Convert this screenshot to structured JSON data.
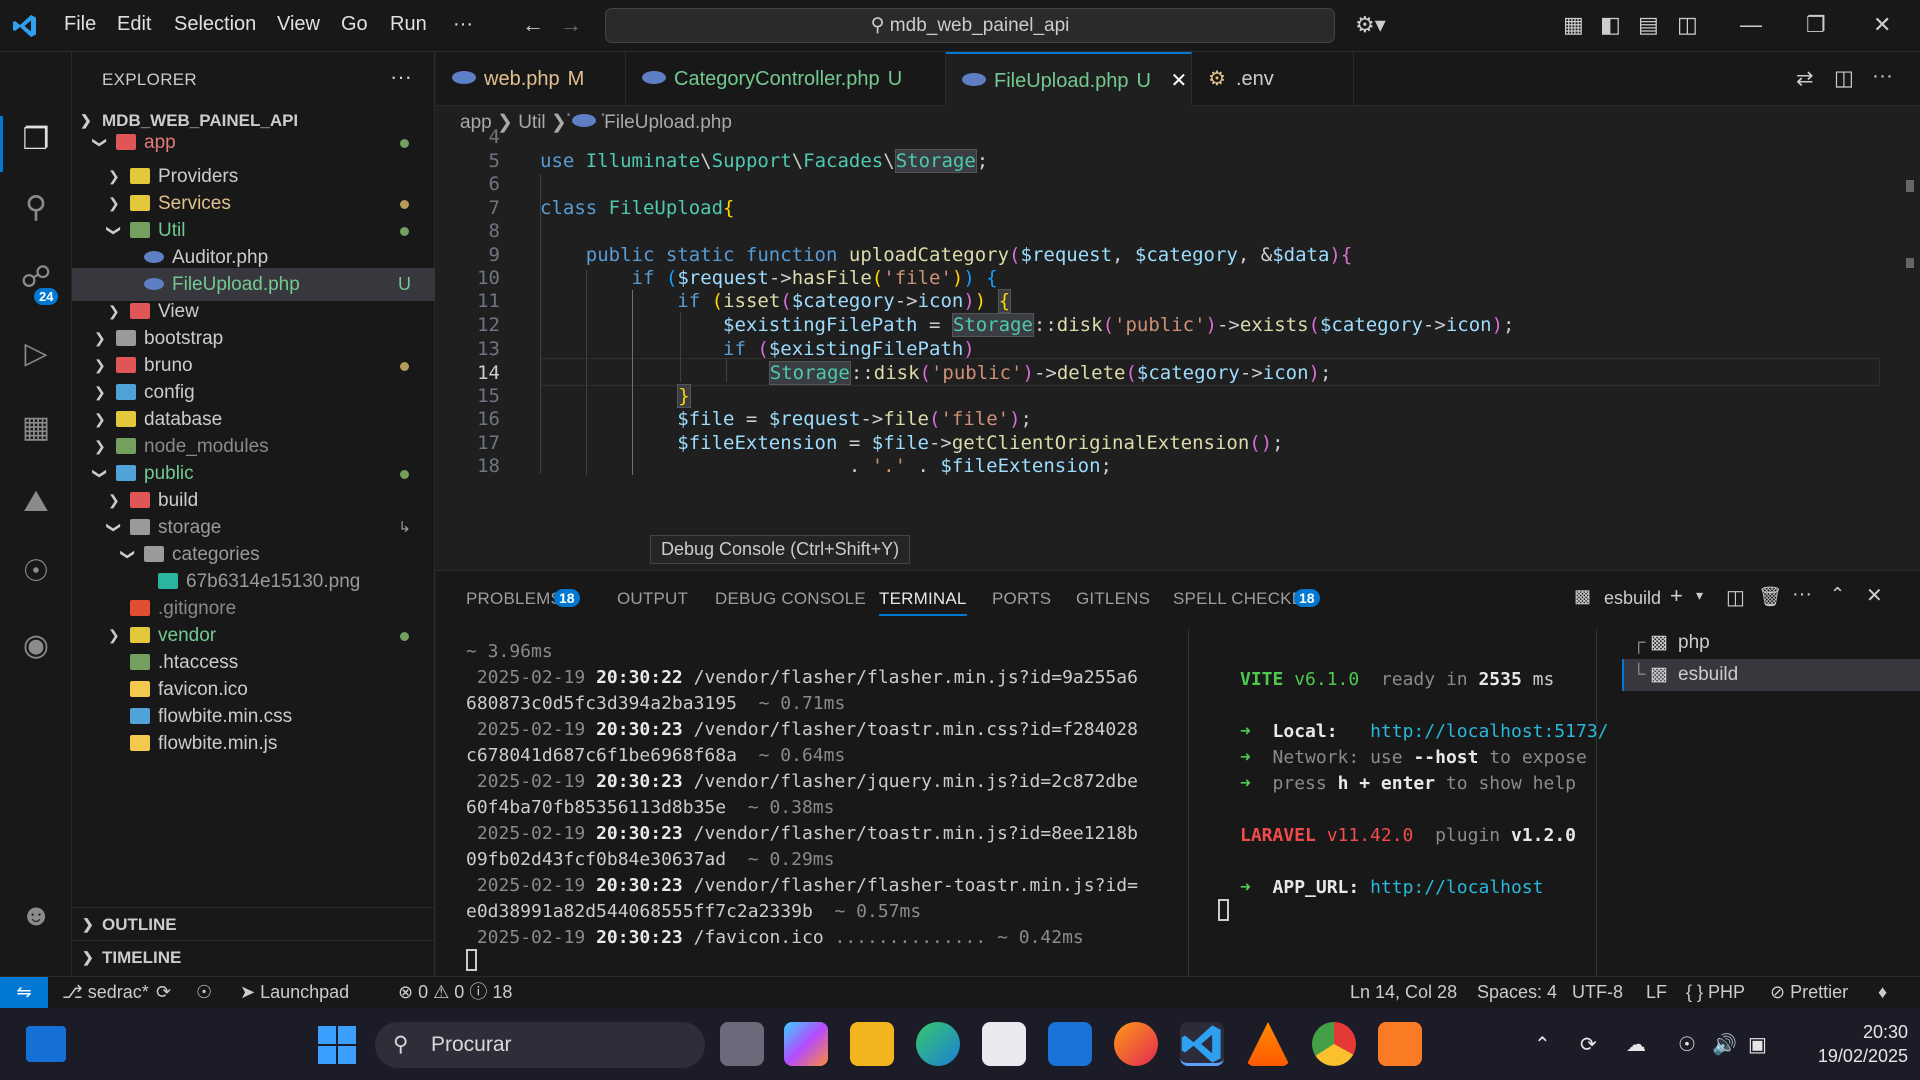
{
  "titlebar": {
    "menu": [
      "File",
      "Edit",
      "Selection",
      "View",
      "Go",
      "Run",
      "···"
    ],
    "search": "mdb_web_painel_api"
  },
  "activity": {
    "scm_badge": "24"
  },
  "sidebar": {
    "title": "EXPLORER",
    "root": "MDB_WEB_PAINEL_API",
    "items": [
      {
        "label": "app"
      },
      {
        "label": "Providers"
      },
      {
        "label": "Services"
      },
      {
        "label": "Util"
      },
      {
        "label": "Auditor.php"
      },
      {
        "label": "FileUpload.php",
        "flag": "U"
      },
      {
        "label": "View"
      },
      {
        "label": "bootstrap"
      },
      {
        "label": "bruno"
      },
      {
        "label": "config"
      },
      {
        "label": "database"
      },
      {
        "label": "node_modules"
      },
      {
        "label": "public"
      },
      {
        "label": "build"
      },
      {
        "label": "storage"
      },
      {
        "label": "categories"
      },
      {
        "label": "67b6314e15130.png"
      },
      {
        "label": ".gitignore"
      },
      {
        "label": "vendor"
      },
      {
        "label": ".htaccess"
      },
      {
        "label": "favicon.ico"
      },
      {
        "label": "flowbite.min.css"
      },
      {
        "label": "flowbite.min.js"
      }
    ],
    "outline": "OUTLINE",
    "timeline": "TIMELINE"
  },
  "tabs": [
    {
      "label": "web.php",
      "flag": "M"
    },
    {
      "label": "CategoryController.php",
      "flag": "U"
    },
    {
      "label": "FileUpload.php",
      "flag": "U"
    },
    {
      "label": ".env"
    }
  ],
  "breadcrumbs": [
    "app",
    "Util",
    "FileUpload.php"
  ],
  "editor": {
    "line_numbers": [
      "4",
      "5",
      "6",
      "7",
      "8",
      "9",
      "10",
      "11",
      "12",
      "13",
      "14",
      "15",
      "16",
      "17",
      "18"
    ],
    "tooltip": "Debug Console (Ctrl+Shift+Y)"
  },
  "panel": {
    "tabs": [
      "PROBLEMS",
      "OUTPUT",
      "DEBUG CONSOLE",
      "TERMINAL",
      "PORTS",
      "GITLENS",
      "SPELL CHECKER"
    ],
    "problems_badge": "18",
    "spell_badge": "18",
    "terminal_name": "esbuild",
    "terminals": [
      "php",
      "esbuild"
    ],
    "log": [
      {
        "dur": "~ 3.96ms"
      },
      {
        "date": "2025-02-19",
        "time": "20:30:22",
        "path": "/vendor/flasher/flasher.min.js?id=9a255a6",
        "cont": "680873c0d5fc3d394a2ba3195",
        "dur": "~ 0.71ms"
      },
      {
        "date": "2025-02-19",
        "time": "20:30:23",
        "path": "/vendor/flasher/toastr.min.css?id=f284028",
        "cont": "c678041d687c6f1be6968f68a",
        "dur": "~ 0.64ms"
      },
      {
        "date": "2025-02-19",
        "time": "20:30:23",
        "path": "/vendor/flasher/jquery.min.js?id=2c872dbe",
        "cont": "60f4ba70fb85356113d8b35e",
        "dur": "~ 0.38ms"
      },
      {
        "date": "2025-02-19",
        "time": "20:30:23",
        "path": "/vendor/flasher/toastr.min.js?id=8ee1218b",
        "cont": "09fb02d43fcf0b84e30637ad",
        "dur": "~ 0.29ms"
      },
      {
        "date": "2025-02-19",
        "time": "20:30:23",
        "path": "/vendor/flasher/flasher-toastr.min.js?id=",
        "cont": "e0d38991a82d544068555ff7c2a2339b",
        "dur": "~ 0.57ms"
      },
      {
        "date": "2025-02-19",
        "time": "20:30:23",
        "path": "/favicon.ico",
        "dots": "..............",
        "dur": "~ 0.42ms"
      }
    ],
    "vite": {
      "name": "VITE",
      "version": "v6.1.0",
      "ready": "ready in",
      "ms_value": "2535",
      "ms": "ms",
      "local_label": "Local:",
      "local_url": "http://localhost:5173/",
      "network_label": "Network:",
      "network_text1": "use",
      "network_flag": "--host",
      "network_text2": "to expose",
      "help_text1": "press",
      "help_key": "h + enter",
      "help_text2": "to show help",
      "laravel": "LARAVEL",
      "laravel_version": "v11.42.0",
      "plugin": "plugin",
      "plugin_version": "v1.2.0",
      "app_url_label": "APP_URL:",
      "app_url": "http://localhost"
    }
  },
  "status": {
    "branch": "sedrac*",
    "launchpad": "Launchpad",
    "errors": "0",
    "warnings": "0",
    "info": "18",
    "position": "Ln 14, Col 28",
    "spaces": "Spaces: 4",
    "encoding": "UTF-8",
    "eol": "LF",
    "language": "PHP",
    "prettier": "Prettier"
  },
  "taskbar": {
    "search": "Procurar",
    "time": "20:30",
    "date": "19/02/2025"
  },
  "colors": {
    "accent": "#0078d4",
    "bg": "#1f1f1f",
    "sidebar": "#181818",
    "modified": "#e2c08d",
    "untracked": "#73c991"
  }
}
